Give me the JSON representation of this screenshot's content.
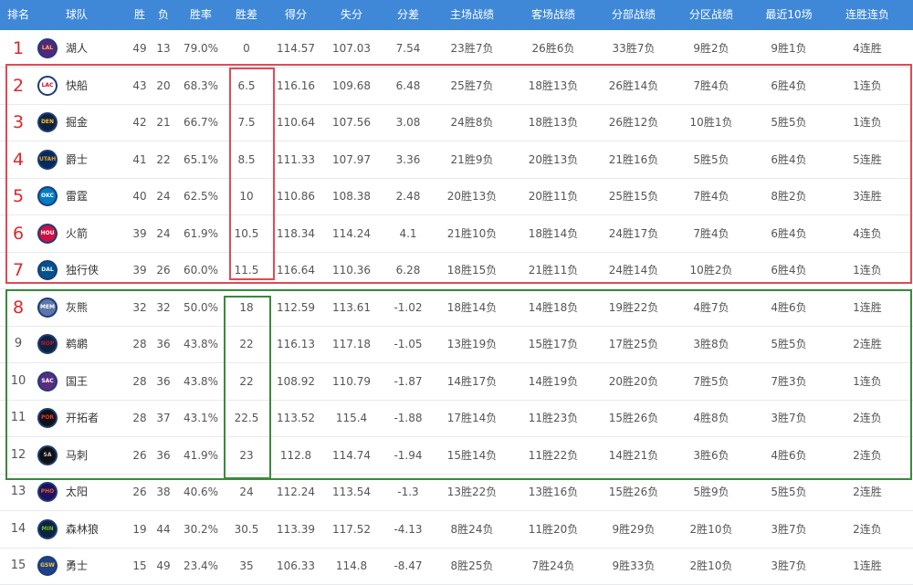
{
  "headers": [
    "排名",
    "球队",
    "胜",
    "负",
    "胜率",
    "胜差",
    "得分",
    "失分",
    "分差",
    "主场战绩",
    "客场战绩",
    "分部战绩",
    "分区战绩",
    "最近10场",
    "连胜连负"
  ],
  "colors": {
    "header_bg": "#3f88d8",
    "rank_highlight": "#e0262c",
    "red_box": "#e04a54",
    "green_box": "#3a8a3a"
  },
  "rows": [
    {
      "rank": "1",
      "team": "湖人",
      "logo": "LAL",
      "logo_bg": "#552583",
      "logo_fg": "#fdb927",
      "w": "49",
      "l": "13",
      "pct": "79.0%",
      "gb": "0",
      "pf": "114.57",
      "pa": "107.03",
      "diff": "7.54",
      "home": "23胜7负",
      "away": "26胜6负",
      "conf": "33胜7负",
      "div": "9胜2负",
      "last10": "9胜1负",
      "streak": "4连胜"
    },
    {
      "rank": "2",
      "team": "快船",
      "logo": "LAC",
      "logo_bg": "#ffffff",
      "logo_fg": "#c8102e",
      "w": "43",
      "l": "20",
      "pct": "68.3%",
      "gb": "6.5",
      "pf": "116.16",
      "pa": "109.68",
      "diff": "6.48",
      "home": "25胜7负",
      "away": "18胜13负",
      "conf": "26胜14负",
      "div": "7胜4负",
      "last10": "6胜4负",
      "streak": "1连负"
    },
    {
      "rank": "3",
      "team": "掘金",
      "logo": "DEN",
      "logo_bg": "#0e2240",
      "logo_fg": "#fec524",
      "w": "42",
      "l": "21",
      "pct": "66.7%",
      "gb": "7.5",
      "pf": "110.64",
      "pa": "107.56",
      "diff": "3.08",
      "home": "24胜8负",
      "away": "18胜13负",
      "conf": "26胜12负",
      "div": "10胜1负",
      "last10": "5胜5负",
      "streak": "1连负"
    },
    {
      "rank": "4",
      "team": "爵士",
      "logo": "UTAH",
      "logo_bg": "#002b5c",
      "logo_fg": "#f9a01b",
      "w": "41",
      "l": "22",
      "pct": "65.1%",
      "gb": "8.5",
      "pf": "111.33",
      "pa": "107.97",
      "diff": "3.36",
      "home": "21胜9负",
      "away": "20胜13负",
      "conf": "21胜16负",
      "div": "5胜5负",
      "last10": "6胜4负",
      "streak": "5连胜"
    },
    {
      "rank": "5",
      "team": "雷霆",
      "logo": "OKC",
      "logo_bg": "#007ac1",
      "logo_fg": "#ffffff",
      "w": "40",
      "l": "24",
      "pct": "62.5%",
      "gb": "10",
      "pf": "110.86",
      "pa": "108.38",
      "diff": "2.48",
      "home": "20胜13负",
      "away": "20胜11负",
      "conf": "25胜15负",
      "div": "7胜4负",
      "last10": "8胜2负",
      "streak": "3连胜"
    },
    {
      "rank": "6",
      "team": "火箭",
      "logo": "HOU",
      "logo_bg": "#ce1141",
      "logo_fg": "#ffffff",
      "w": "39",
      "l": "24",
      "pct": "61.9%",
      "gb": "10.5",
      "pf": "118.34",
      "pa": "114.24",
      "diff": "4.1",
      "home": "21胜10负",
      "away": "18胜14负",
      "conf": "24胜17负",
      "div": "7胜4负",
      "last10": "6胜4负",
      "streak": "4连负"
    },
    {
      "rank": "7",
      "team": "独行侠",
      "logo": "DAL",
      "logo_bg": "#00538c",
      "logo_fg": "#ffffff",
      "w": "39",
      "l": "26",
      "pct": "60.0%",
      "gb": "11.5",
      "pf": "116.64",
      "pa": "110.36",
      "diff": "6.28",
      "home": "18胜15负",
      "away": "21胜11负",
      "conf": "24胜14负",
      "div": "10胜2负",
      "last10": "6胜4负",
      "streak": "1连负"
    },
    {
      "rank": "8",
      "team": "灰熊",
      "logo": "MEM",
      "logo_bg": "#5d76a9",
      "logo_fg": "#ffffff",
      "w": "32",
      "l": "32",
      "pct": "50.0%",
      "gb": "18",
      "pf": "112.59",
      "pa": "113.61",
      "diff": "-1.02",
      "home": "18胜14负",
      "away": "14胜18负",
      "conf": "19胜22负",
      "div": "4胜7负",
      "last10": "4胜6负",
      "streak": "1连胜"
    },
    {
      "rank": "9",
      "team": "鹈鹕",
      "logo": "NOP",
      "logo_bg": "#0c2340",
      "logo_fg": "#c8102e",
      "w": "28",
      "l": "36",
      "pct": "43.8%",
      "gb": "22",
      "pf": "116.13",
      "pa": "117.18",
      "diff": "-1.05",
      "home": "13胜19负",
      "away": "15胜17负",
      "conf": "17胜25负",
      "div": "3胜8负",
      "last10": "5胜5负",
      "streak": "2连胜"
    },
    {
      "rank": "10",
      "team": "国王",
      "logo": "SAC",
      "logo_bg": "#5a2d81",
      "logo_fg": "#ffffff",
      "w": "28",
      "l": "36",
      "pct": "43.8%",
      "gb": "22",
      "pf": "108.92",
      "pa": "110.79",
      "diff": "-1.87",
      "home": "14胜17负",
      "away": "14胜19负",
      "conf": "20胜20负",
      "div": "7胜5负",
      "last10": "7胜3负",
      "streak": "1连负"
    },
    {
      "rank": "11",
      "team": "开拓者",
      "logo": "POR",
      "logo_bg": "#111111",
      "logo_fg": "#e03a3e",
      "w": "28",
      "l": "37",
      "pct": "43.1%",
      "gb": "22.5",
      "pf": "113.52",
      "pa": "115.4",
      "diff": "-1.88",
      "home": "17胜14负",
      "away": "11胜23负",
      "conf": "15胜26负",
      "div": "4胜8负",
      "last10": "3胜7负",
      "streak": "2连负"
    },
    {
      "rank": "12",
      "team": "马刺",
      "logo": "SA",
      "logo_bg": "#111111",
      "logo_fg": "#c4ced4",
      "w": "26",
      "l": "36",
      "pct": "41.9%",
      "gb": "23",
      "pf": "112.8",
      "pa": "114.74",
      "diff": "-1.94",
      "home": "15胜14负",
      "away": "11胜22负",
      "conf": "14胜21负",
      "div": "3胜6负",
      "last10": "4胜6负",
      "streak": "2连负"
    },
    {
      "rank": "13",
      "team": "太阳",
      "logo": "PHO",
      "logo_bg": "#1d1160",
      "logo_fg": "#e56020",
      "w": "26",
      "l": "38",
      "pct": "40.6%",
      "gb": "24",
      "pf": "112.24",
      "pa": "113.54",
      "diff": "-1.3",
      "home": "13胜22负",
      "away": "13胜16负",
      "conf": "15胜26负",
      "div": "5胜9负",
      "last10": "5胜5负",
      "streak": "2连胜"
    },
    {
      "rank": "14",
      "team": "森林狼",
      "logo": "MIN",
      "logo_bg": "#0c2340",
      "logo_fg": "#78be20",
      "w": "19",
      "l": "44",
      "pct": "30.2%",
      "gb": "30.5",
      "pf": "113.39",
      "pa": "117.52",
      "diff": "-4.13",
      "home": "8胜24负",
      "away": "11胜20负",
      "conf": "9胜29负",
      "div": "2胜10负",
      "last10": "3胜7负",
      "streak": "2连负"
    },
    {
      "rank": "15",
      "team": "勇士",
      "logo": "GSW",
      "logo_bg": "#1d428a",
      "logo_fg": "#ffc72c",
      "w": "15",
      "l": "49",
      "pct": "23.4%",
      "gb": "35",
      "pf": "106.33",
      "pa": "114.8",
      "diff": "-8.47",
      "home": "8胜25负",
      "away": "7胜24负",
      "conf": "9胜33负",
      "div": "2胜10负",
      "last10": "3胜7负",
      "streak": "1连胜"
    }
  ]
}
